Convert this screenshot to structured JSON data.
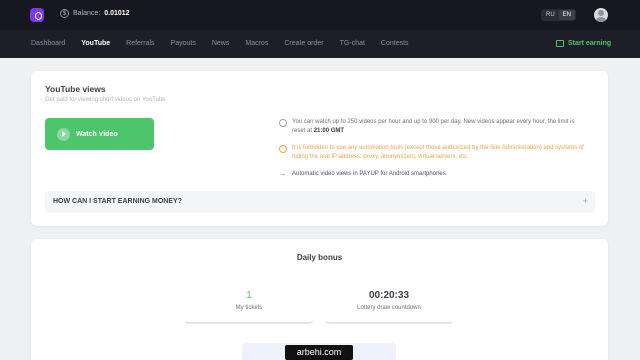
{
  "header": {
    "balance_label": "Balance:",
    "balance_value": "0.01012",
    "coin_symbol": "$",
    "languages": [
      "RU",
      "EN"
    ],
    "active_language": "EN"
  },
  "nav": {
    "items": [
      "Dashboard",
      "YouTube",
      "Referrals",
      "Payouts",
      "News",
      "Macros",
      "Create order",
      "TG-chat",
      "Contests"
    ],
    "active": "YouTube",
    "start_earning": "Start earning"
  },
  "youtube_card": {
    "title": "YouTube views",
    "subtitle": "Get paid for viewing short videos on YouTube",
    "watch_button": "Watch Video",
    "info_1_pre": "You can watch up to 250 videos per hour and up to 900 per day. New videos appear every hour, the limit is reset at ",
    "info_1_time": "21:00 GMT",
    "info_2": "It is forbidden to use any automation tools (except those authorized by the Site Administration) and systems of hiding the real IP address: proxy, anonymizers, virtual servers, etc.",
    "info_3": "Automatic video views in PAYUP for Android smartphones",
    "faq_title": "HOW CAN I START EARNING MONEY?",
    "faq_toggle": "+"
  },
  "bonus_card": {
    "title": "Daily bonus",
    "tickets_value": "1",
    "tickets_label": "My tickets",
    "countdown_value": "00:20:33",
    "countdown_label": "Lottery draw countdown"
  },
  "watermark": "arbehi.com",
  "colors": {
    "accent_green": "#4cc56c",
    "warning_orange": "#f0a24e",
    "brand_purple": "#7c3aed",
    "topbar_bg": "#17171f"
  }
}
